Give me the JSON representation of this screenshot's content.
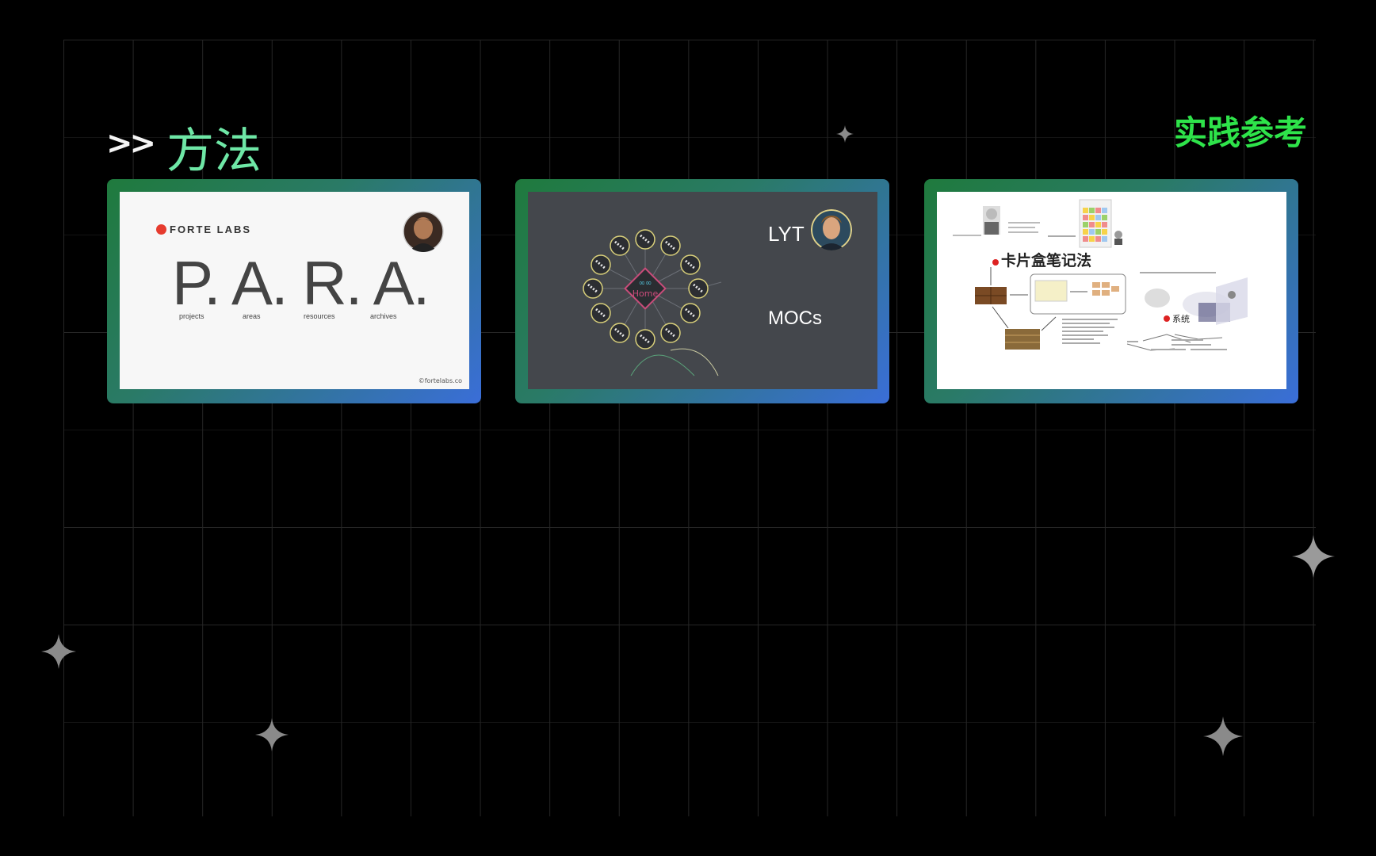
{
  "header": {
    "arrows": ">>",
    "title": "方法",
    "right_label": "实践参考"
  },
  "cards": [
    {
      "brand": "FORTE LABS",
      "big_text": "P. A. R. A.",
      "labels": [
        "projects",
        "areas",
        "resources",
        "archives"
      ],
      "copyright": "©fortelabs.co"
    },
    {
      "title": "LYT",
      "subtitle": "MOCs",
      "hub_label": "Home"
    },
    {
      "title": "卡片盒笔记法",
      "sub_label": "系统"
    }
  ],
  "colors": {
    "title_green": "#6ee7a6",
    "right_green": "#2ee34a",
    "card_gradient_start": "#1f7a3d",
    "card_gradient_end": "#3a6ed8"
  }
}
